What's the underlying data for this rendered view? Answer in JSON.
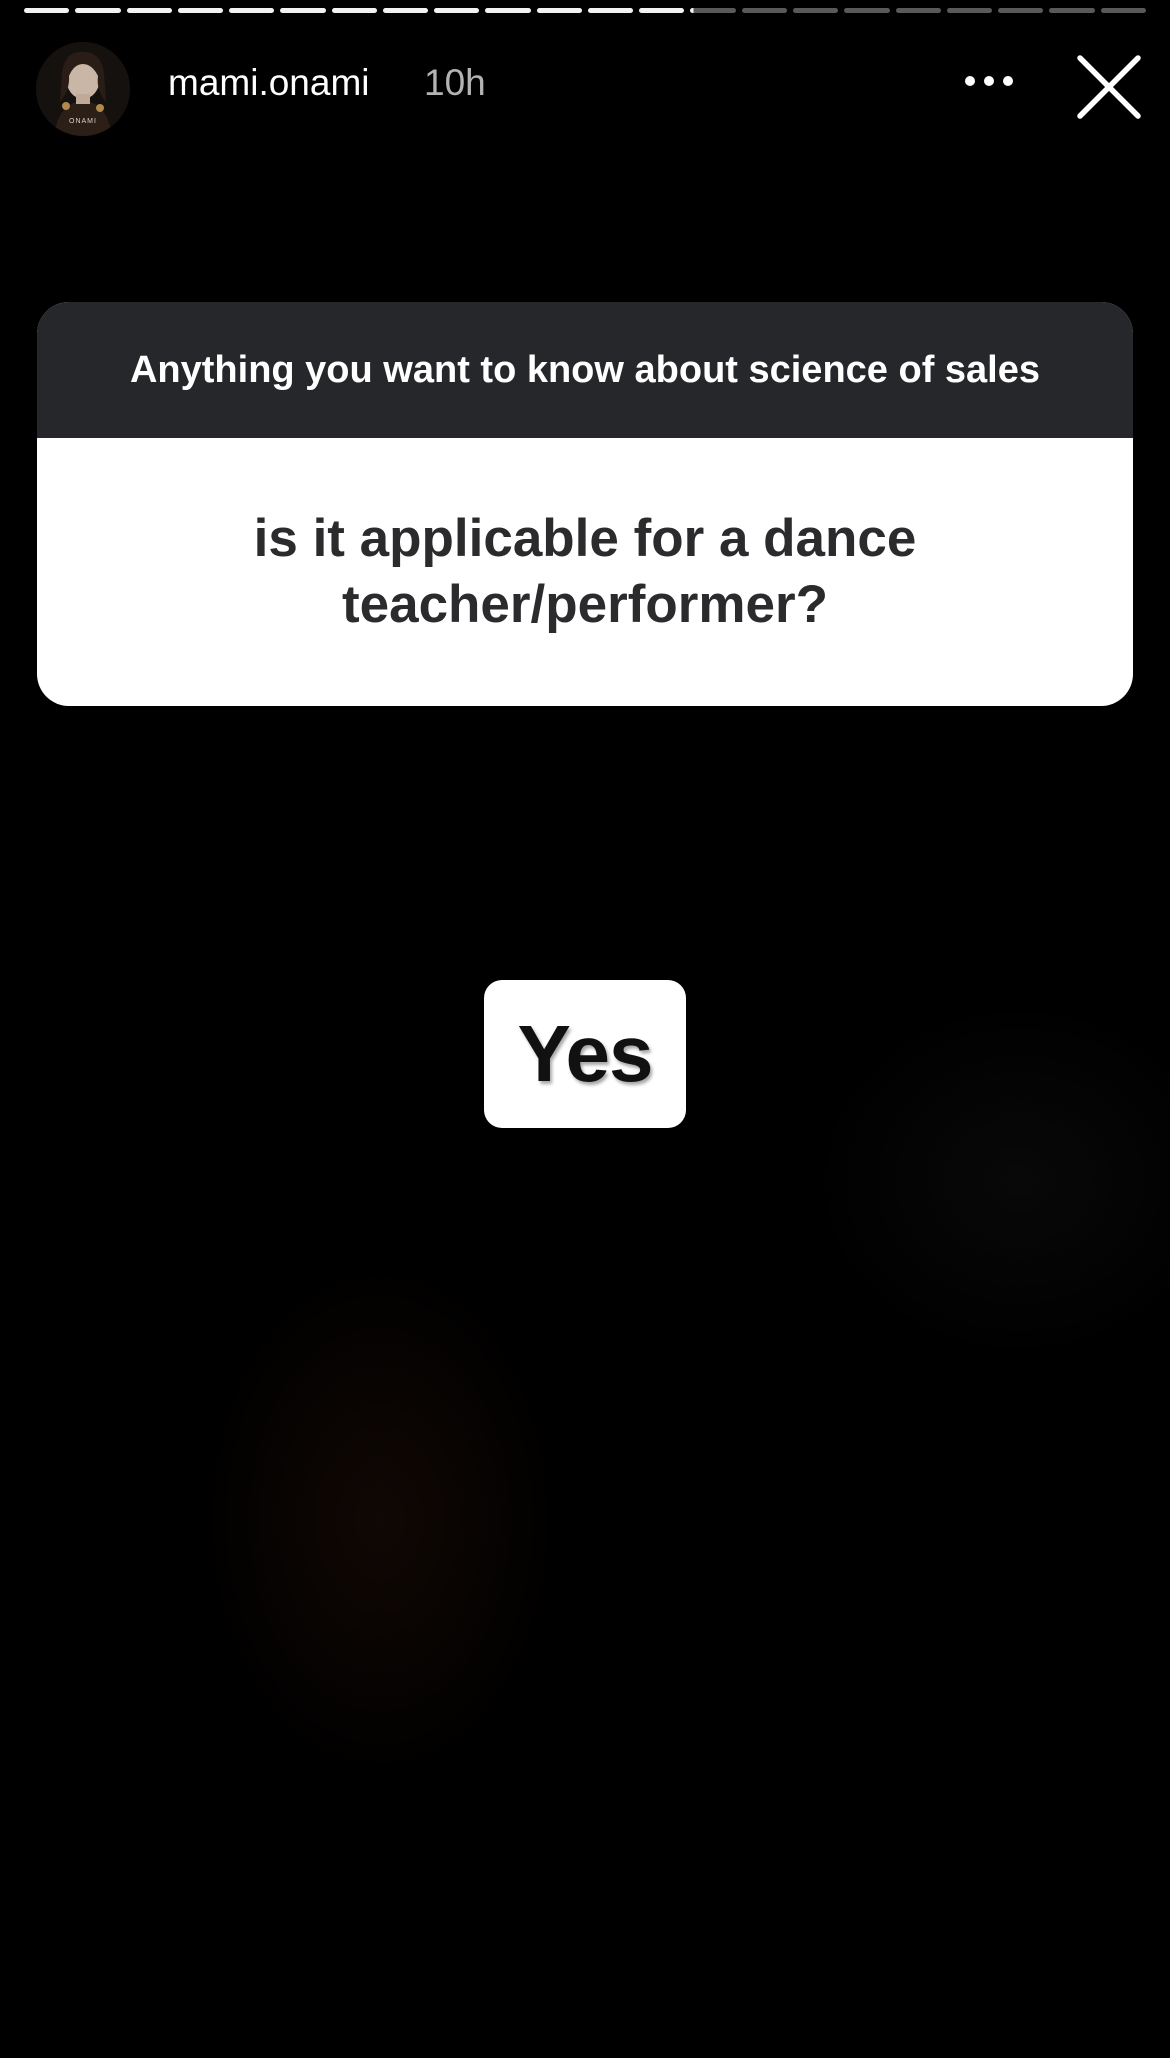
{
  "story": {
    "progress": {
      "segments_total": 22,
      "segments_done": 13,
      "current_segment_fraction": 0.08
    }
  },
  "header": {
    "username": "mami.onami",
    "time": "10h",
    "avatar_brand": "ONAMI",
    "more_icon": "more-horizontal-icon",
    "close_icon": "close-icon"
  },
  "question_sticker": {
    "prompt": "Anything you want to know about science of sales",
    "question": "is it applicable for a dance teacher/performer?",
    "header_color": "#26272b"
  },
  "answer": {
    "text": "Yes"
  }
}
